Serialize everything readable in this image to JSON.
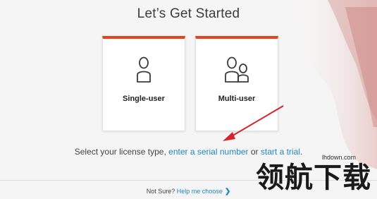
{
  "title": "Let’s Get Started",
  "cards": [
    {
      "label": "Single-user",
      "icon": "single-user-icon"
    },
    {
      "label": "Multi-user",
      "icon": "multi-user-icon"
    }
  ],
  "license_prompt": {
    "prefix": "Select your license type, ",
    "serial_link": "enter a serial number",
    "middle": " or ",
    "trial_link": "start a trial",
    "suffix": "."
  },
  "footer": {
    "prefix": "Not Sure? ",
    "help_link": "Help me choose"
  },
  "watermark": {
    "site": "lhdown.com",
    "text": "领航下载"
  },
  "colors": {
    "accent": "#e8411b",
    "link": "#1f85c7",
    "annotation_arrow": "#d8232a"
  }
}
